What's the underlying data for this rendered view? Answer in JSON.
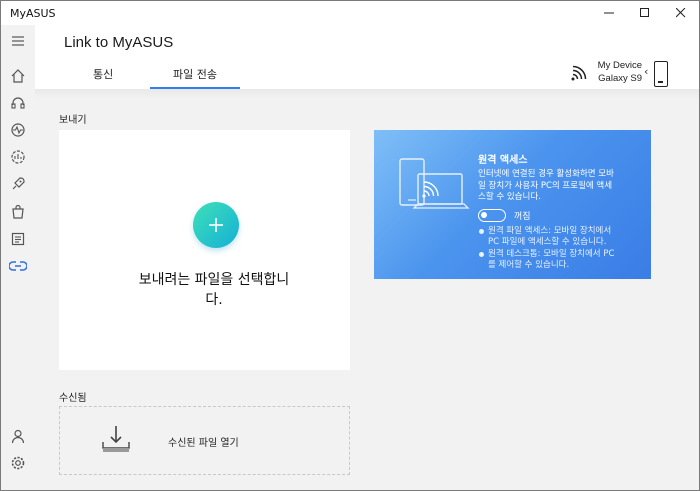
{
  "window": {
    "title": "MyASUS"
  },
  "header": {
    "title": "Link to MyASUS",
    "tabs": [
      {
        "label": "통신",
        "active": false
      },
      {
        "label": "파일 전송",
        "active": true
      }
    ],
    "device": {
      "line1": "My Device",
      "line2": "Galaxy S9"
    }
  },
  "sidebar": {
    "items": [
      {
        "name": "menu-icon"
      },
      {
        "name": "home-icon"
      },
      {
        "name": "customer-support-icon"
      },
      {
        "name": "system-diagnosis-icon"
      },
      {
        "name": "hardware-settings-icon"
      },
      {
        "name": "app-deals-icon"
      },
      {
        "name": "store-icon"
      },
      {
        "name": "news-icon"
      },
      {
        "name": "link-to-myasus-icon",
        "active": true
      },
      {
        "name": "user-icon"
      },
      {
        "name": "settings-icon"
      }
    ]
  },
  "send": {
    "section_label": "보내기",
    "line1": "보내려는 파일을 선택합니",
    "line2": "다."
  },
  "remote": {
    "title": "원격 액세스",
    "desc_line1": "인터넷에 연결된 경우 활성화하면 모바",
    "desc_line2": "일 장치가 사용자 PC의 프로필에 액세",
    "desc_line3": "스할 수 있습니다.",
    "toggle_label": "꺼짐",
    "toggle_on": false,
    "bullets": [
      {
        "line1": "원격 파일 액세스: 모바일 장치에서",
        "line2": "PC 파일에 액세스할 수 있습니다."
      },
      {
        "line1": "원격 데스크톱: 모바일 장치에서 PC",
        "line2": "를 제어할 수 있습니다."
      }
    ]
  },
  "received": {
    "section_label": "수신됨",
    "open_label": "수신된 파일 열기"
  },
  "colors": {
    "accent": "#2f80ed",
    "plus_gradient_start": "#3ee0b8",
    "plus_gradient_end": "#14b0d6",
    "remote_gradient_start": "#7fbff7",
    "remote_gradient_end": "#3a7de6"
  }
}
